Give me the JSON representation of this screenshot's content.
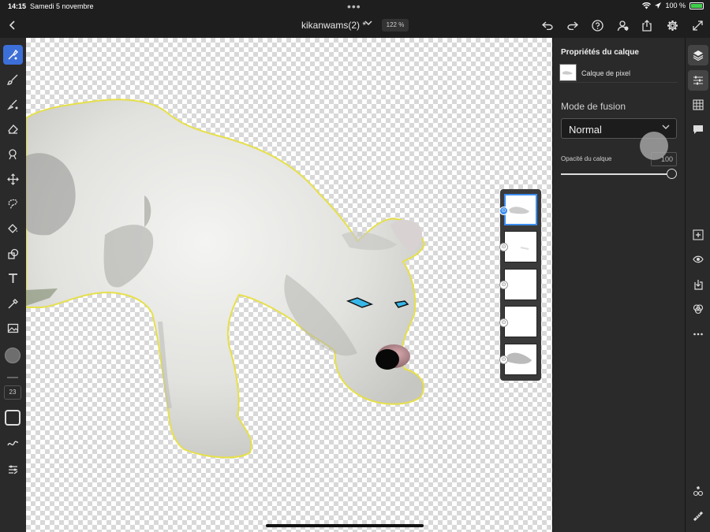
{
  "status_bar": {
    "time": "14:15",
    "date": "Samedi 5 novembre",
    "battery": "100 %"
  },
  "title_bar": {
    "document_title": "kikanwams(2) *",
    "zoom": "122 %"
  },
  "left_toolbar": {
    "brush_size": "23"
  },
  "layers_panel": {
    "title": "Propriétés du calque",
    "layer_name": "Calque de pixel",
    "blend_mode_label": "Mode de fusion",
    "blend_mode_value": "Normal",
    "opacity_label": "Opacité du calque",
    "opacity_value": "100"
  },
  "colors": {
    "accent": "#3c6fd8",
    "selection_outline": "#e6e04a",
    "panel_bg": "#2a2a2a",
    "app_bg": "#1e1e1e"
  }
}
